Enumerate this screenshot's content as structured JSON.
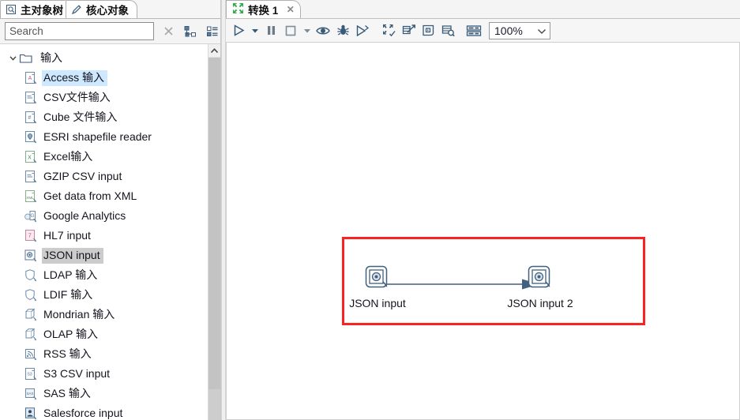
{
  "left_panel": {
    "tabs": [
      {
        "label": "主对象树",
        "icon": "view-tree-icon",
        "active": false
      },
      {
        "label": "核心对象",
        "icon": "pencil-icon",
        "active": true
      }
    ],
    "search": {
      "placeholder": "Search",
      "value": "",
      "clear_icon": "close-icon",
      "tree_view_icon": "tree-view-icon",
      "list_view_icon": "list-view-icon"
    },
    "tree": {
      "group": {
        "label": "输入",
        "icon": "folder-icon",
        "expanded": true,
        "twisty_icon": "chevron-down-icon"
      },
      "items": [
        {
          "label": "Access 输入",
          "icon": "access-input-icon",
          "state": "hover"
        },
        {
          "label": "CSV文件输入",
          "icon": "csv-file-input-icon",
          "state": "normal"
        },
        {
          "label": "Cube 文件输入",
          "icon": "cube-file-input-icon",
          "state": "normal"
        },
        {
          "label": "ESRI shapefile reader",
          "icon": "esri-shapefile-icon",
          "state": "normal"
        },
        {
          "label": "Excel输入",
          "icon": "excel-input-icon",
          "state": "normal"
        },
        {
          "label": "GZIP CSV input",
          "icon": "gzip-csv-input-icon",
          "state": "normal"
        },
        {
          "label": "Get data from XML",
          "icon": "xml-input-icon",
          "state": "normal"
        },
        {
          "label": "Google Analytics",
          "icon": "google-analytics-icon",
          "state": "normal"
        },
        {
          "label": "HL7 input",
          "icon": "hl7-input-icon",
          "state": "normal"
        },
        {
          "label": "JSON input",
          "icon": "json-input-icon",
          "state": "selected"
        },
        {
          "label": "LDAP 输入",
          "icon": "ldap-input-icon",
          "state": "normal"
        },
        {
          "label": "LDIF 输入",
          "icon": "ldif-input-icon",
          "state": "normal"
        },
        {
          "label": "Mondrian 输入",
          "icon": "mondrian-input-icon",
          "state": "normal"
        },
        {
          "label": "OLAP 输入",
          "icon": "olap-input-icon",
          "state": "normal"
        },
        {
          "label": "RSS 输入",
          "icon": "rss-input-icon",
          "state": "normal"
        },
        {
          "label": "S3 CSV input",
          "icon": "s3-csv-input-icon",
          "state": "normal"
        },
        {
          "label": "SAS 输入",
          "icon": "sas-input-icon",
          "state": "normal"
        },
        {
          "label": "Salesforce input",
          "icon": "salesforce-input-icon",
          "state": "normal"
        }
      ]
    },
    "scrollbar": {
      "up_arrow_icon": "chevron-up-icon"
    }
  },
  "right_panel": {
    "editor_tab": {
      "label": "转换 1",
      "icon": "transformation-icon",
      "close_label": "✕"
    },
    "toolbar": {
      "buttons": [
        {
          "name": "run-button",
          "icon": "play-icon"
        },
        {
          "name": "run-options-dropdown",
          "icon": "caret-down-icon"
        },
        {
          "name": "pause-button",
          "icon": "pause-icon"
        },
        {
          "name": "stop-button",
          "icon": "stop-icon"
        },
        {
          "name": "stop-options-dropdown",
          "icon": "caret-down-icon"
        },
        {
          "name": "preview-button",
          "icon": "eye-icon"
        },
        {
          "name": "debug-button",
          "icon": "bug-icon"
        },
        {
          "name": "replay-button",
          "icon": "play-outline-icon"
        },
        {
          "name": "verify-button",
          "icon": "verify-transformation-icon"
        },
        {
          "name": "analyze-impact-button",
          "icon": "metrics-icon"
        },
        {
          "name": "show-sql-button",
          "icon": "sql-icon"
        },
        {
          "name": "inspect-data-button",
          "icon": "inspect-data-icon"
        },
        {
          "name": "grid-button",
          "icon": "grid-icon"
        }
      ],
      "zoom": {
        "value": "100%",
        "chevron_icon": "chevron-down-icon"
      }
    },
    "canvas": {
      "annotation": {
        "color": "#fb2222",
        "name": "red-highlight-rectangle"
      },
      "nodes": [
        {
          "label": "JSON input",
          "icon": "json-input-step-icon"
        },
        {
          "label": "JSON input 2",
          "icon": "json-input-step-icon"
        }
      ],
      "hop": {
        "name": "transformation-hop",
        "color": "#41617f",
        "from": "JSON input",
        "to": "JSON input 2"
      }
    }
  },
  "colors": {
    "annotation_red": "#fb2222",
    "hop_blue": "#41617f",
    "selection_gray": "#cccccc",
    "hover_blue": "#cde8ff",
    "toolbar_icon": "#365a78",
    "tab_green": "#2faa4a"
  }
}
